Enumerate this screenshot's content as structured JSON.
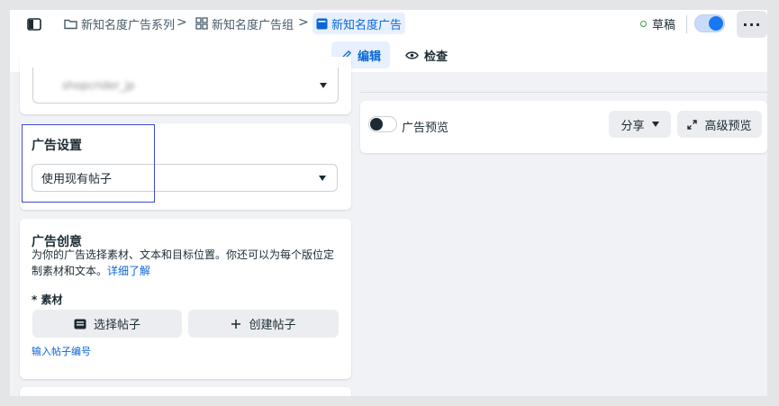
{
  "breadcrumb": {
    "campaign": "新知名度广告系列",
    "adset": "新知名度广告组",
    "ad": "新知名度广告",
    "separator": ">"
  },
  "status": {
    "draft_label": "草稿"
  },
  "more_label": "···",
  "tabs": {
    "edit": "编辑",
    "review": "检查"
  },
  "identity": {
    "page_value": "shopcrider_jp"
  },
  "ad_setup": {
    "title": "广告设置",
    "selected": "使用现有帖子"
  },
  "creative": {
    "title": "广告创意",
    "description": "为你的广告选择素材、文本和目标位置。你还可以为每个版位定制素材和文本。",
    "learn_more": "详细了解",
    "media_label": "* 素材",
    "select_post": "选择帖子",
    "create_post": "创建帖子",
    "enter_post_id": "输入帖子编号"
  },
  "preview": {
    "label": "广告预览",
    "share": "分享",
    "advanced": "高级预览"
  },
  "colors": {
    "accent": "#1877f2",
    "link": "#0a66d8",
    "draft_dot": "#31a24c",
    "highlight": "#3b4ccf"
  }
}
